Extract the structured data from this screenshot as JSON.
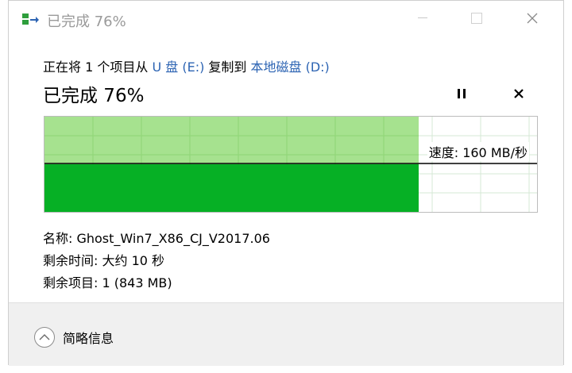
{
  "window": {
    "title": "已完成 76%",
    "controls": {
      "minimize": "—",
      "maximize": "☐",
      "close": "✕"
    }
  },
  "transfer": {
    "prefix": "正在将 1 个项目从 ",
    "source": "U 盘 (E:)",
    "middle": " 复制到 ",
    "destination": "本地磁盘 (D:)",
    "status": "已完成 76%",
    "progress_fraction": 0.76,
    "speed_label": "速度: 160 MB/秒"
  },
  "details": {
    "name": "名称: Ghost_Win7_X86_CJ_V2017.06",
    "time_remaining": "剩余时间: 大约 10 秒",
    "items_remaining": "剩余项目: 1 (843 MB)"
  },
  "footer": {
    "toggle_label": "简略信息"
  },
  "colors": {
    "progress_light": "#a6e28f",
    "progress_dark": "#06b025",
    "link": "#2d64b3",
    "grid": "#d5e8d5"
  }
}
